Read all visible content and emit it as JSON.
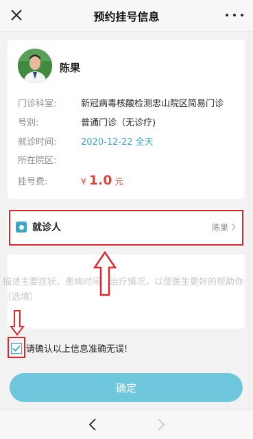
{
  "header": {
    "title": "预约挂号信息"
  },
  "doctor": {
    "name": "陈果"
  },
  "info": {
    "department_label": "门诊科室:",
    "department_value": "新冠病毒核酸检测忠山院区简易门诊",
    "type_label": "号别:",
    "type_value": "普通门诊（无诊疗)",
    "time_label": "就诊时间:",
    "time_value": "2020-12-22 全天",
    "campus_label": "所在院区:",
    "campus_value": "",
    "fee_label": "挂号费:",
    "fee_symbol": "¥",
    "fee_amount": "1.0",
    "fee_unit": "元"
  },
  "patient": {
    "label": "就诊人",
    "value": "陈果"
  },
  "description": {
    "placeholder": "描述主要症状、患病时间及治疗情况，以便医生更好的帮助你（选填）"
  },
  "confirm": {
    "text": "请确认以上信息准确无误!",
    "checked": true
  },
  "actions": {
    "submit_label": "确定"
  },
  "colors": {
    "accent": "#3aa6c9",
    "button": "#6ec7dc",
    "price": "#d8493a",
    "annotation": "#e0262b"
  },
  "icons": {
    "close": "close-icon",
    "more": "more-icon",
    "patient": "id-card-icon",
    "chevron": "chevron-right-icon",
    "back": "back-icon",
    "forward": "forward-icon"
  }
}
